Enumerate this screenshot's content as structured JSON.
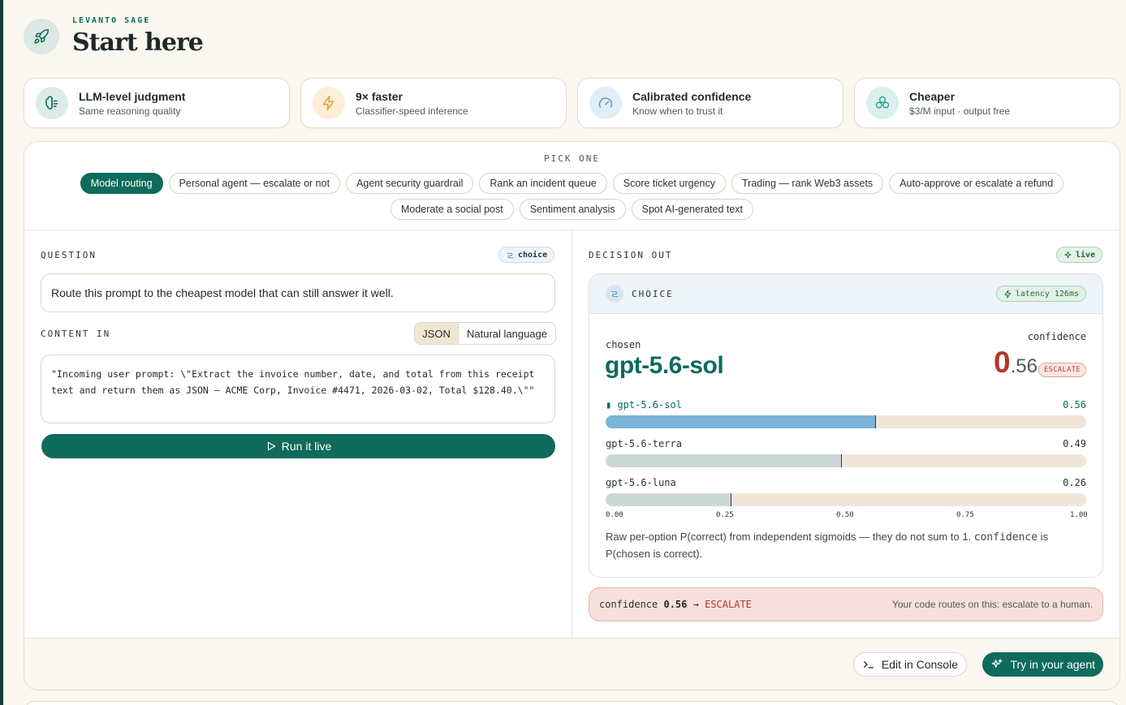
{
  "header": {
    "eyebrow": "LEVANTO SAGE",
    "title": "Start here",
    "logo_icon": "rocket-icon"
  },
  "features": [
    {
      "title": "LLM-level judgment",
      "subtitle": "Same reasoning quality",
      "icon": "brain-icon",
      "color": "#0f6b5c"
    },
    {
      "title": "9× faster",
      "subtitle": "Classifier-speed inference",
      "icon": "lightning-icon",
      "color": "#e0a33a"
    },
    {
      "title": "Calibrated confidence",
      "subtitle": "Know when to trust it",
      "icon": "gauge-icon",
      "color": "#5b9bc9"
    },
    {
      "title": "Cheaper",
      "subtitle": "$3/M input · output free",
      "icon": "coins-icon",
      "color": "#2a9c8f"
    }
  ],
  "pick": {
    "label": "PICK ONE",
    "options": [
      "Model routing",
      "Personal agent — escalate or not",
      "Agent security guardrail",
      "Rank an incident queue",
      "Score ticket urgency",
      "Trading — rank Web3 assets",
      "Auto-approve or escalate a refund",
      "Moderate a social post",
      "Sentiment analysis",
      "Spot AI-generated text"
    ],
    "selected": "Model routing"
  },
  "question": {
    "label": "QUESTION",
    "tag": "choice",
    "text": "Route this prompt to the cheapest model that can still answer it well."
  },
  "content": {
    "label": "CONTENT IN",
    "format_options": [
      "JSON",
      "Natural language"
    ],
    "selected_format": "JSON",
    "text": "\"Incoming user prompt: \\\"Extract the invoice number, date, and total from this receipt text and return them as JSON — ACME Corp, Invoice #4471, 2026-03-02, Total $128.40.\\\"\""
  },
  "run_button": "Run it live",
  "decision": {
    "label": "DECISION OUT",
    "live_tag": "live",
    "card_title": "CHOICE",
    "latency": "latency 126ms",
    "chosen_label": "chosen",
    "chosen": "gpt-5.6-sol",
    "confidence_label": "confidence",
    "confidence_int": "0",
    "confidence_dec": ".56",
    "confidence_badge": "ESCALATE",
    "options": [
      {
        "name": "gpt-5.6-sol",
        "display": "▮ gpt-5.6-sol",
        "value": 0.56,
        "value_text": "0.56",
        "selected": true
      },
      {
        "name": "gpt-5.6-terra",
        "display": "gpt-5.6-terra",
        "value": 0.49,
        "value_text": "0.49",
        "selected": false
      },
      {
        "name": "gpt-5.6-luna",
        "display": "gpt-5.6-luna",
        "value": 0.26,
        "value_text": "0.26",
        "selected": false
      }
    ],
    "axis_ticks": [
      "0.00",
      "0.25",
      "0.50",
      "0.75",
      "1.00"
    ],
    "note_before": "Raw per-option P(correct) from independent sigmoids — they do not sum to 1. ",
    "note_mono": "confidence",
    "note_after": " is P(chosen is correct).",
    "selected_color": "#7ab3d8",
    "unselected_color": "#cdd9d7"
  },
  "escalation": {
    "prefix": "confidence",
    "value": "0.56",
    "arrow": "→",
    "action": "ESCALATE",
    "message": "Your code routes on this: escalate to a human."
  },
  "footer": {
    "console_button": "Edit in Console",
    "try_button": "Try in your agent"
  }
}
